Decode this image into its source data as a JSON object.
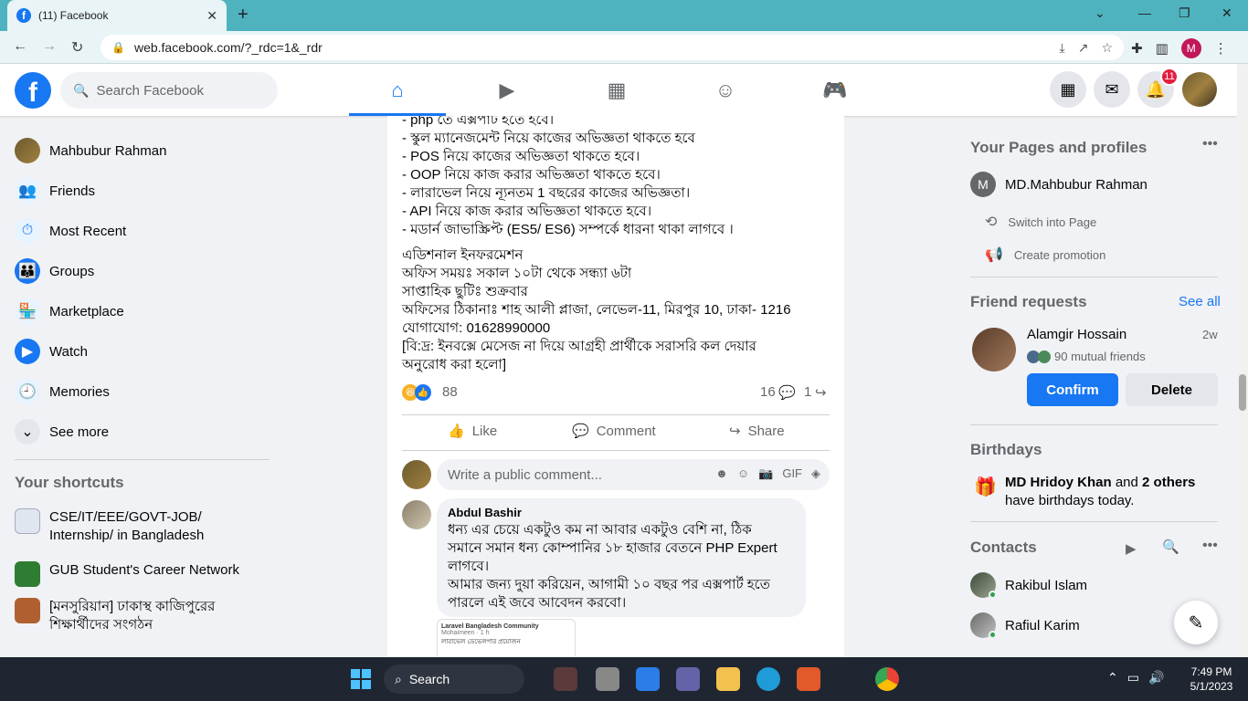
{
  "browser": {
    "tab_title": "(11) Facebook",
    "url": "web.facebook.com/?_rdc=1&_rdr",
    "profile_initial": "M"
  },
  "header": {
    "search_placeholder": "Search Facebook",
    "notifications_count": "11"
  },
  "left_nav": {
    "items": [
      {
        "label": "Mahbubur Rahman",
        "icon": "profile-avatar"
      },
      {
        "label": "Friends",
        "icon": "friends-icon"
      },
      {
        "label": "Most Recent",
        "icon": "most-recent-icon"
      },
      {
        "label": "Groups",
        "icon": "groups-icon"
      },
      {
        "label": "Marketplace",
        "icon": "marketplace-icon"
      },
      {
        "label": "Watch",
        "icon": "watch-icon"
      },
      {
        "label": "Memories",
        "icon": "memories-icon"
      },
      {
        "label": "See more",
        "icon": "chevron-down-icon"
      }
    ],
    "shortcuts_title": "Your shortcuts",
    "shortcuts": [
      "CSE/IT/EEE/GOVT-JOB/ Internship/ in Bangladesh",
      "GUB Student's Career Network",
      "[মনসুরিয়ান] ঢাকাস্থ কাজিপুরের শিক্ষার্থীদের সংগঠন"
    ]
  },
  "post": {
    "lines": [
      "- php তে এক্সপার্ট হতে হবে।",
      "- স্কুল ম্যানেজমেন্ট নিয়ে কাজের অভিজ্ঞতা থাকতে হবে",
      "- POS নিয়ে কাজের অভিজ্ঞতা থাকতে হবে।",
      "- OOP নিয়ে কাজ করার অভিজ্ঞতা থাকতে হবে।",
      "- লারাভেল নিয়ে ন্যূনতম 1 বছরের কাজের অভিজ্ঞতা।",
      "- API নিয়ে কাজ করার অভিজ্ঞতা থাকতে হবে।",
      "- মডার্ন জাভাস্ক্রিপ্ট (ES5/ ES6) সম্পর্কে ধারনা থাকা লাগবে ।"
    ],
    "info_lines": [
      "এডিশনাল ইনফরমেশন",
      "অফিস সময়ঃ সকাল ১০টা থেকে সন্ধ্যা ৬টা",
      "সাপ্তাহিক ছুটিঃ  শুক্রবার",
      "অফিসের ঠিকানাঃ শাহ আলী প্লাজা, লেভেল-11, মিরপুর 10, ঢাকা- 1216",
      "যোগাযোগ: 01628990000",
      "[বি:দ্র: ইনবক্সে মেসেজ না দিয়ে আগ্রহী প্রার্থীকে সরাসরি কল দেয়ার",
      "অনুরোধ করা হলো]"
    ],
    "reaction_count": "88",
    "comment_count": "16",
    "share_count": "1",
    "like_label": "Like",
    "comment_label": "Comment",
    "share_label": "Share",
    "comment_placeholder": "Write a public comment...",
    "comment": {
      "author": "Abdul Bashir",
      "lines": [
        "ধন্য এর চেয়ে একটুও কম না আবার একটুও বেশি না, ঠিক",
        "সমানে সমান ধন্য কোম্পানির ১৮ হাজার বেতনে PHP Expert",
        "লাগবে।",
        "আমার জন্য দুয়া করিয়েন, আগামী ১০ বছর পর এক্সপার্ট হতে",
        "পারলে এই জবে আবেদন করবো।"
      ],
      "thumb_title": "Laravel Bangladesh Community",
      "thumb_sub": "Mohaimeen · 1 h",
      "thumb_text": "লারাভেল ডেভেলপার প্রয়োজন"
    }
  },
  "right": {
    "pages_title": "Your Pages and profiles",
    "page_name": "MD.Mahbubur Rahman",
    "page_initial": "M",
    "switch_label": "Switch into Page",
    "promo_label": "Create promotion",
    "friend_requests_title": "Friend requests",
    "see_all": "See all",
    "requester": "Alamgir Hossain",
    "request_time": "2w",
    "mutual": "90 mutual friends",
    "confirm": "Confirm",
    "delete": "Delete",
    "birthdays_title": "Birthdays",
    "birthday_name": "MD Hridoy Khan",
    "birthday_and": " and ",
    "birthday_others": "2 others",
    "birthday_suffix": "have birthdays today.",
    "contacts_title": "Contacts",
    "contacts": [
      "Rakibul Islam",
      "Rafiul Karim"
    ]
  },
  "taskbar": {
    "search_label": "Search",
    "time": "7:49 PM",
    "date": "5/1/2023"
  },
  "colors": {
    "brand": "#1877f2",
    "tabstrip": "#4fb3bf",
    "badge": "#e41e3f"
  }
}
